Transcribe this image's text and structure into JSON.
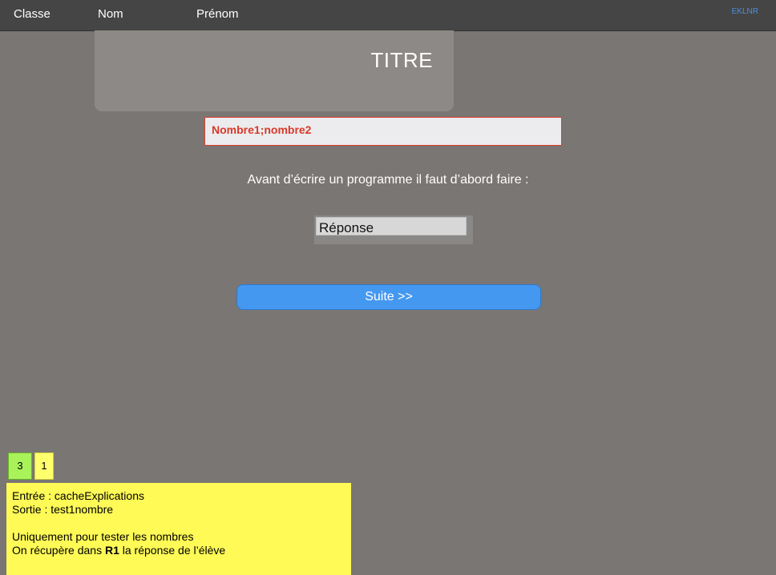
{
  "header": {
    "classe_label": "Classe",
    "nom_label": "Nom",
    "prenom_label": "Prénom",
    "brand": "EKLNR"
  },
  "title_card": {
    "title": "TITRE"
  },
  "question": {
    "text": "Nombre1;nombre2"
  },
  "instruction": {
    "text": "Avant d’écrire un programme il faut d’abord faire :"
  },
  "answer": {
    "placeholder": "Réponse",
    "value": ""
  },
  "suite_button": {
    "label": "Suite >>"
  },
  "badges": {
    "green": "3",
    "yellow": "1"
  },
  "notes": {
    "line1": "Entrée : cacheExplications",
    "line2": "Sortie : test1nombre",
    "line3": "Uniquement pour tester les nombres",
    "line4_prefix": "On récupère dans ",
    "line4_bold": "R1",
    "line4_suffix": " la réponse de l’élève"
  },
  "colors": {
    "background": "#7a7673",
    "topbar": "#454545",
    "accent_blue": "#4598f0",
    "error_red": "#e23a2a",
    "note_yellow": "#fffa56",
    "badge_green": "#a9f25a"
  }
}
